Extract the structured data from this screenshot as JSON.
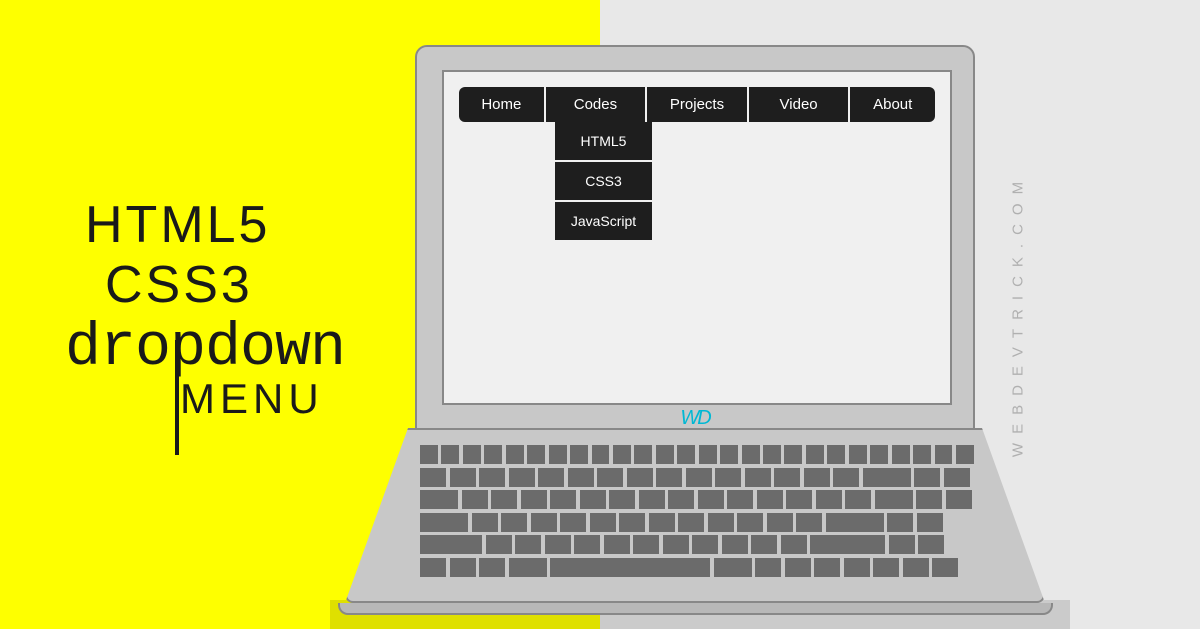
{
  "title": {
    "line1": "HTML5",
    "line2": "CSS3",
    "line3": "dropdown",
    "line4": "MENU"
  },
  "nav": {
    "items": [
      {
        "label": "Home"
      },
      {
        "label": "Codes"
      },
      {
        "label": "Projects"
      },
      {
        "label": "Video"
      },
      {
        "label": "About"
      }
    ]
  },
  "dropdown": {
    "items": [
      {
        "label": "HTML5"
      },
      {
        "label": "CSS3"
      },
      {
        "label": "JavaScript"
      }
    ]
  },
  "logo": "WD",
  "watermark": "WEBDEVTRICK.COM"
}
